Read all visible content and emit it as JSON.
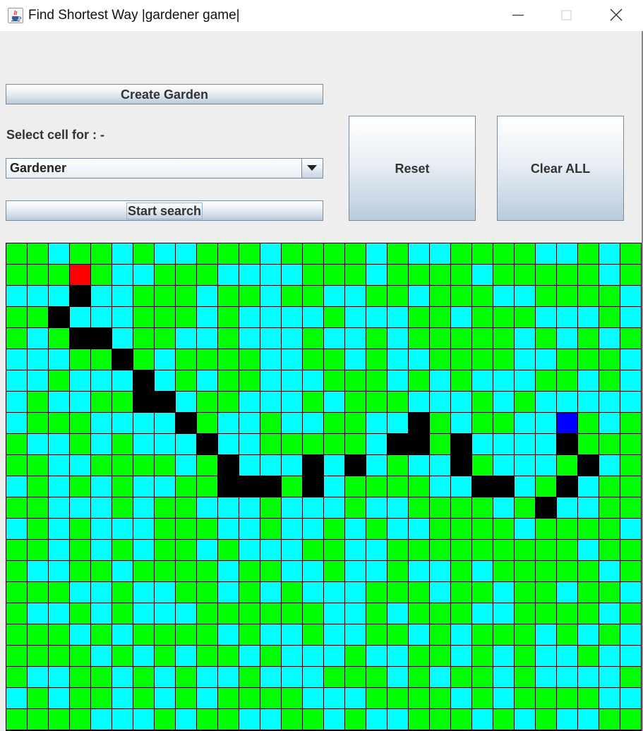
{
  "window": {
    "title": "Find Shortest Way |gardener game|",
    "icon": "java-cup-icon",
    "controls": [
      "minimize-icon",
      "maximize-icon",
      "close-icon"
    ]
  },
  "controls": {
    "create_garden_label": "Create Garden",
    "select_cell_label": "Select cell for : -",
    "cell_type_selected": "Gardener",
    "start_search_label": "Start search",
    "reset_label": "Reset",
    "clear_all_label": "Clear ALL"
  },
  "colors": {
    "grass": "#00ff00",
    "water": "#00ffff",
    "gardener": "#ff0000",
    "target": "#0000ff",
    "path": "#000000",
    "panel": "#eeeeee"
  },
  "grid": {
    "cols": 30,
    "legend": {
      "G": "grass",
      "C": "water",
      "R": "gardener",
      "B": "target",
      "K": "path"
    },
    "rows": [
      "GGCGGCGCCGGGCGGGGCGCCGGGGCCGCGC",
      "GGGRGCCGGGCCCCGGGCGGGGCGGGGGCGG",
      "CCCKCCGGGCGGCGGCCGGCGGGCCGGGGCG",
      "GGKCCCGGGCGCCCCGCCCGGCGGGCCCGCC",
      "GCGKKCGGCCGCCCGCCGCGGGGGCGCGCGG",
      "CCCGGKGCGGGGCCGGCGCCGGGGCCGGGCC",
      "CCGCCCKCGCGGCCCGGGCGCGCCCGGCGCC",
      "CGCCGGKKCGGCCCGCGGGCCCGCGCCCCCC",
      "CGGGCCCCKGCCGCCGGCCKGCGGCCBGCGC",
      "GCCGCGCCCKCCGGGGGCKKGKCCCCKGGGC",
      "GGCCGGGGCGKCCCKCKCGCCKGCCCGKCGC",
      "CGCGCGCCGGKKKGKCGGGGCCKKCGKCGGC",
      "GGCCCGCGGCCCGCCCGCCGGGGCGKCCGGC",
      "CGCGCCCGGGCCGCCGCGCCGGGGCGGGGCC",
      "GGCGCGCGGCGCCCGGCCGGGGGGGGGCGGC",
      "GCCGGCGGGGCGGCCGCCGCCGCGGGGGCGC",
      "GGGCCGCCGGCGCGCCCGGGCGGCGGCGGCG",
      "GCCGCGCCCGGGGGGCCGCGGGCCGGGGCGC",
      "GGGCGCGGGGCGCCGCCGGCGCGGGCGCGCC",
      "GGGGCGCGCGGCGCCCGCCGGCGCGCCGCCG",
      "GCCGGCGCGCCGCCCGGGCGCGGCGCCCCGG",
      "CGCGGCGCGCGGGGCCCGGGGCGCGGGGCCG",
      "GGGGCCCGCGGCCGGCGCCGGGCGCGCCGGG"
    ]
  }
}
